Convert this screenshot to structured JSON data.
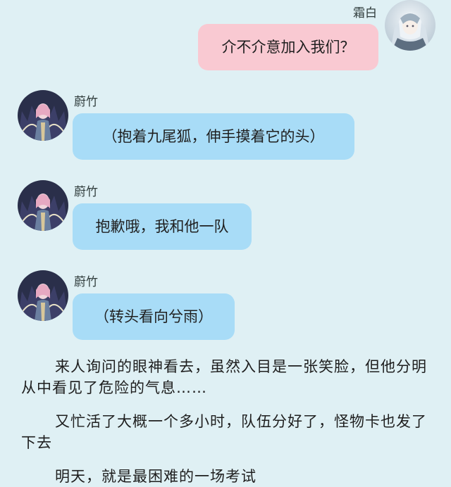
{
  "messages": [
    {
      "side": "right",
      "sender": "霜白",
      "text": "介不介意加入我们？",
      "bubble_color": "#f9c9d2"
    },
    {
      "side": "left",
      "sender": "蔚竹",
      "text": "（抱着九尾狐，伸手摸着它的头）",
      "bubble_color": "#a8dcf7"
    },
    {
      "side": "left",
      "sender": "蔚竹",
      "text": "抱歉哦，我和他一队",
      "bubble_color": "#a8dcf7"
    },
    {
      "side": "left",
      "sender": "蔚竹",
      "text": "（转头看向兮雨）",
      "bubble_color": "#a8dcf7"
    }
  ],
  "narration": [
    "来人询问的眼神看去，虽然入目是一张笑脸，但他分明从中看见了危险的气息……",
    "又忙活了大概一个多小时，队伍分好了，怪物卡也发了下去",
    "明天，就是最困难的一场考试"
  ],
  "colors": {
    "background": "#dff0f4",
    "pink_bubble": "#f9c9d2",
    "blue_bubble": "#a8dcf7"
  }
}
